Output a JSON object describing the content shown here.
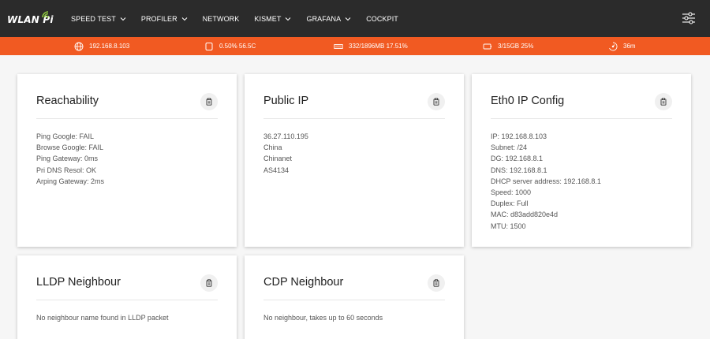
{
  "brand": {
    "logo_text": "WLAN Pi"
  },
  "nav": {
    "items": [
      {
        "label": "SPEED TEST",
        "dropdown": true
      },
      {
        "label": "PROFILER",
        "dropdown": true
      },
      {
        "label": "NETWORK",
        "dropdown": false
      },
      {
        "label": "KISMET",
        "dropdown": true
      },
      {
        "label": "GRAFANA",
        "dropdown": true
      },
      {
        "label": "COCKPIT",
        "dropdown": false
      }
    ],
    "settings_icon": "sliders-icon"
  },
  "status": {
    "ip": "192.168.8.103",
    "cpu": "0.50% 56.5C",
    "memory": "332/1896MB 17.51%",
    "disk": "3/15GB 25%",
    "uptime": "36m"
  },
  "cards": {
    "reachability": {
      "title": "Reachability",
      "lines": [
        "Ping Google: FAIL",
        "Browse Google: FAIL",
        "Ping Gateway: 0ms",
        "Pri DNS Resol: OK",
        "Arping Gateway: 2ms"
      ]
    },
    "public_ip": {
      "title": "Public IP",
      "lines": [
        "36.27.110.195",
        "China",
        "Chinanet",
        "AS4134"
      ]
    },
    "eth0": {
      "title": "Eth0 IP Config",
      "lines": [
        "IP: 192.168.8.103",
        "Subnet: /24",
        "DG: 192.168.8.1",
        "DNS: 192.168.8.1",
        "DHCP server address: 192.168.8.1",
        "Speed: 1000",
        "Duplex: Full",
        "MAC: d83add820e4d",
        "MTU: 1500"
      ]
    },
    "lldp": {
      "title": "LLDP Neighbour",
      "lines": [
        "No neighbour name found in LLDP packet"
      ]
    },
    "cdp": {
      "title": "CDP Neighbour",
      "lines": [
        "No neighbour, takes up to 60 seconds"
      ]
    }
  },
  "colors": {
    "topbar": "#2b2b2b",
    "accent": "#f15a22",
    "background": "#f6f6f6",
    "card": "#ffffff"
  }
}
